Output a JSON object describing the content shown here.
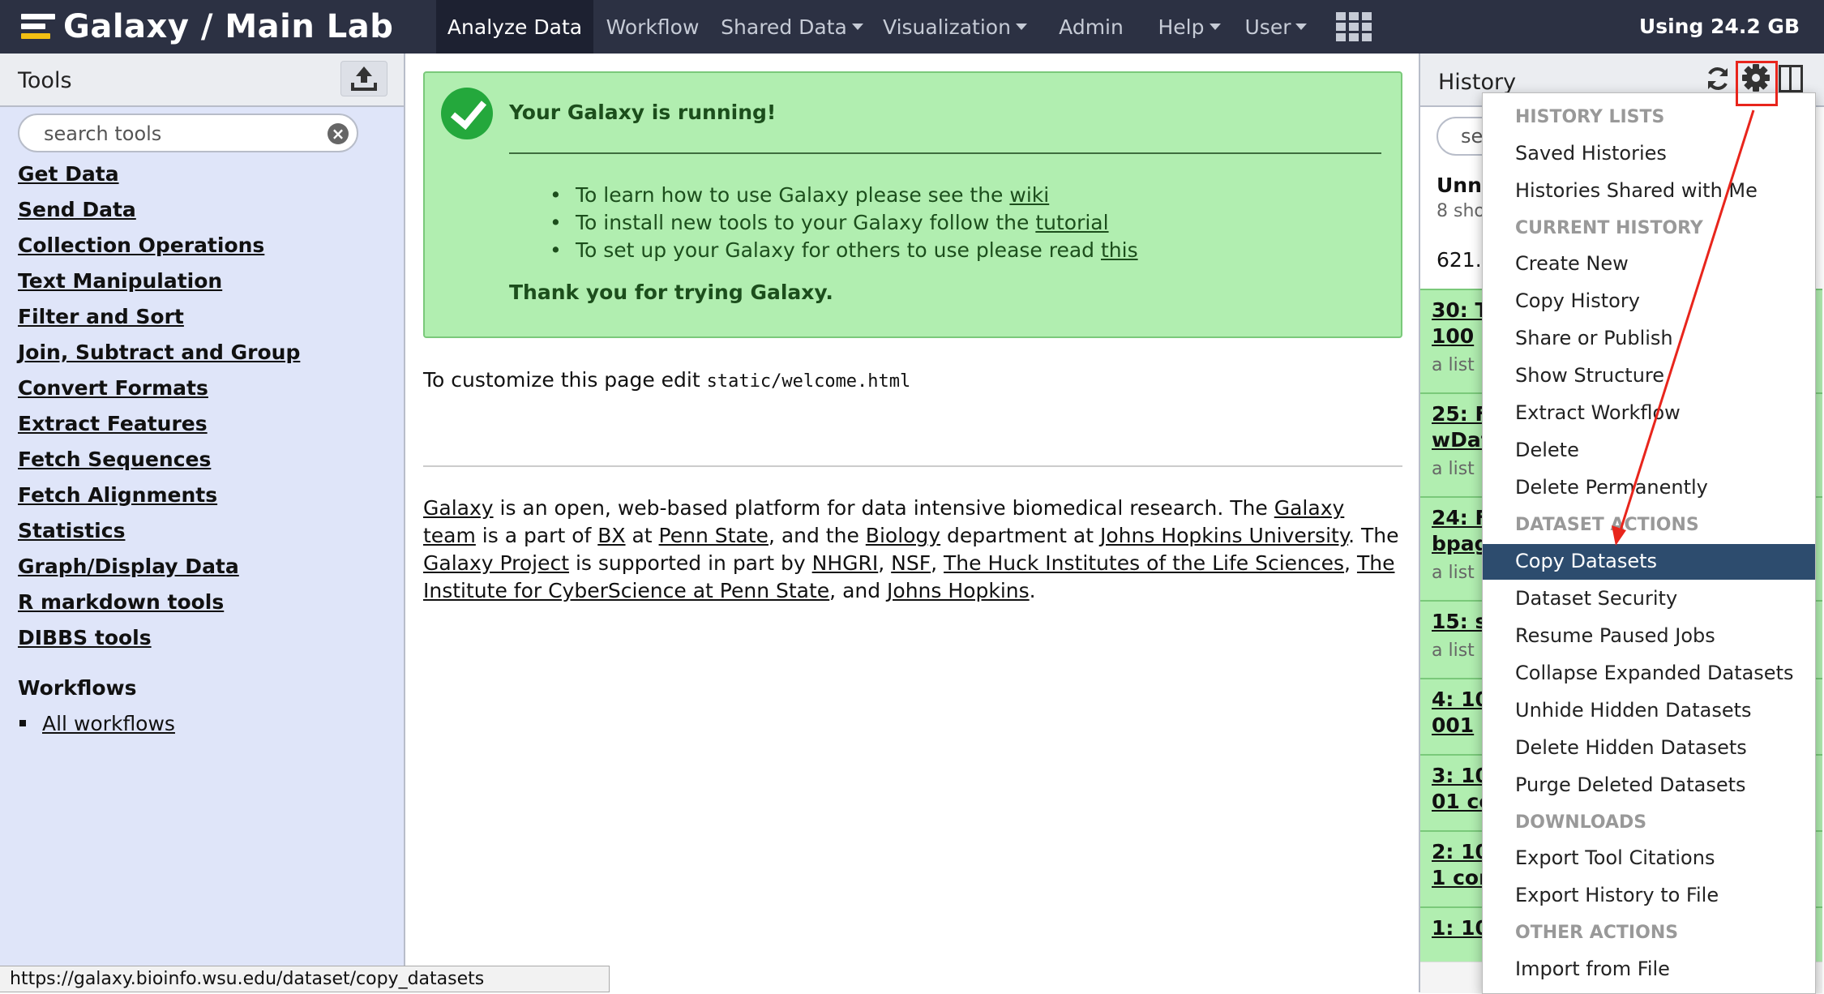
{
  "masthead": {
    "brand": "Galaxy / Main Lab",
    "nav": [
      {
        "label": "Analyze Data",
        "active": true
      },
      {
        "label": "Workflow"
      },
      {
        "label": "Shared Data",
        "dropdown": true
      },
      {
        "label": "Visualization",
        "dropdown": true
      },
      {
        "label": "Admin"
      },
      {
        "label": "Help",
        "dropdown": true
      },
      {
        "label": "User",
        "dropdown": true
      }
    ],
    "quota": "Using 24.2 GB"
  },
  "tools": {
    "title": "Tools",
    "search_placeholder": "search tools",
    "sections": [
      "Get Data",
      "Send Data",
      "Collection Operations",
      "Text Manipulation",
      "Filter and Sort",
      "Join, Subtract and Group",
      "Convert Formats",
      "Extract Features",
      "Fetch Sequences",
      "Fetch Alignments",
      "Statistics",
      "Graph/Display Data",
      "R markdown tools",
      "DIBBS tools"
    ],
    "workflows_title": "Workflows",
    "workflows_item": "All workflows"
  },
  "center": {
    "alert_title": "Your Galaxy is running!",
    "alert_items": [
      {
        "text": "To learn how to use Galaxy please see the ",
        "link": "wiki"
      },
      {
        "text": "To install new tools to your Galaxy follow the ",
        "link": "tutorial"
      },
      {
        "text": "To set up your Galaxy for others to use please read ",
        "link": "this"
      }
    ],
    "alert_thanks": "Thank you for trying Galaxy.",
    "customize_text": "To customize this page edit ",
    "customize_code": "static/welcome.html",
    "about": {
      "galaxy": "Galaxy",
      "t1": " is an open, web-based platform for data intensive biomedical research. The ",
      "galaxy_team": "Galaxy team",
      "t2": " is a part of ",
      "bx": "BX",
      "t3": " at ",
      "penn_state": "Penn State",
      "t4": ", and the ",
      "biology": "Biology",
      "t5": " department at ",
      "jhu": "Johns Hopkins University",
      "t6": ". The ",
      "galaxy_project": "Galaxy Project",
      "t7": " is supported in part by ",
      "nhgri": "NHGRI",
      "t8": ", ",
      "nsf": "NSF",
      "t9": ", ",
      "huck": "The Huck Institutes of the Life Sciences",
      "t10": ", ",
      "cyber": "The Institute for CyberScience at Penn State",
      "t11": ", and ",
      "jh": "Johns Hopkins",
      "t12": "."
    }
  },
  "history": {
    "title": "History",
    "search_placeholder": "sea",
    "name": "Unna",
    "sub": "8 sho",
    "size": "621.2",
    "datasets": [
      {
        "l1": "30: T",
        "l2": "100 ",
        "sub": "a list"
      },
      {
        "l1": "25: F",
        "l2": "wDat",
        "sub": "a list"
      },
      {
        "l1": "24: F",
        "l2": "bpag",
        "sub": "a list"
      },
      {
        "l1": "15: s",
        "sub": "a list"
      },
      {
        "l1": "4: 10",
        "l2": "001 "
      },
      {
        "l1": "3: 10",
        "l2": "01 co"
      },
      {
        "l1": "2: 10",
        "l2": "1 cor"
      },
      {
        "l1": "1: 10"
      }
    ]
  },
  "dropdown": [
    {
      "label": "HISTORY LISTS",
      "header": true
    },
    {
      "label": "Saved Histories"
    },
    {
      "label": "Histories Shared with Me"
    },
    {
      "label": "CURRENT HISTORY",
      "header": true
    },
    {
      "label": "Create New"
    },
    {
      "label": "Copy History"
    },
    {
      "label": "Share or Publish"
    },
    {
      "label": "Show Structure"
    },
    {
      "label": "Extract Workflow"
    },
    {
      "label": "Delete"
    },
    {
      "label": "Delete Permanently"
    },
    {
      "label": "DATASET ACTIONS",
      "header": true
    },
    {
      "label": "Copy Datasets",
      "selected": true
    },
    {
      "label": "Dataset Security"
    },
    {
      "label": "Resume Paused Jobs"
    },
    {
      "label": "Collapse Expanded Datasets"
    },
    {
      "label": "Unhide Hidden Datasets"
    },
    {
      "label": "Delete Hidden Datasets"
    },
    {
      "label": "Purge Deleted Datasets"
    },
    {
      "label": "DOWNLOADS",
      "header": true
    },
    {
      "label": "Export Tool Citations"
    },
    {
      "label": "Export History to File"
    },
    {
      "label": "OTHER ACTIONS",
      "header": true
    },
    {
      "label": "Import from File"
    }
  ],
  "statusbar": "https://galaxy.bioinfo.wsu.edu/dataset/copy_datasets",
  "colors": {
    "masthead": "#2c3143",
    "tool_panel": "#dfe5f9",
    "alert_bg": "#b1eeb0",
    "selected_item": "#2d4c6e",
    "annotation_red": "#e8251c"
  }
}
